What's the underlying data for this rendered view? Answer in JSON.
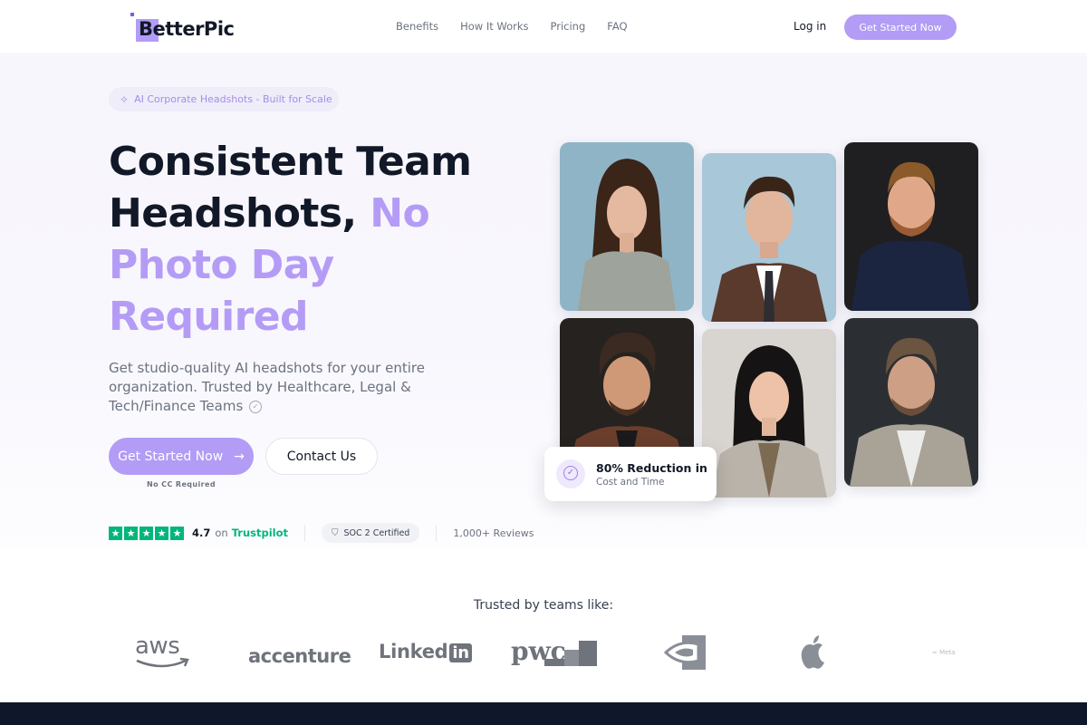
{
  "nav": {
    "brand": "BetterPic",
    "links": [
      "Benefits",
      "How It Works",
      "Pricing",
      "FAQ"
    ],
    "login_label": "Log in",
    "cta_label": "Get Started Now"
  },
  "hero": {
    "pill_label": "AI Corporate Headshots - Built for Scale",
    "pill_icon": "sparkles-icon",
    "headline_line1": "Consistent Team",
    "headline_line2a": "Headshots,",
    "headline_line2b": "No",
    "headline_line3": "Photo Day",
    "headline_line4": "Required",
    "subtitle": "Get studio-quality AI headshots for your entire organization. Trusted by Healthcare, Legal & Tech/Finance Teams",
    "primary_cta": "Get Started Now",
    "primary_cta_arrow": "→",
    "secondary_cta": "Contact Us",
    "no_cc": "No CC Required",
    "rating": "4.7",
    "rating_on": "on",
    "trustpilot": "Trustpilot",
    "soc": "SOC 2 Certified",
    "reviews": "1,000+ Reviews",
    "accent_color": "#b29cf5",
    "trustpilot_color": "#00b67a"
  },
  "stat_card": {
    "title": "80% Reduction in",
    "subtitle": "Cost and Time",
    "icon": "check-circle-icon"
  },
  "trusted": {
    "label": "Trusted by teams like:",
    "logos": [
      "aws",
      "accenture",
      "Linked",
      "in",
      "pwc",
      "Meta"
    ]
  }
}
